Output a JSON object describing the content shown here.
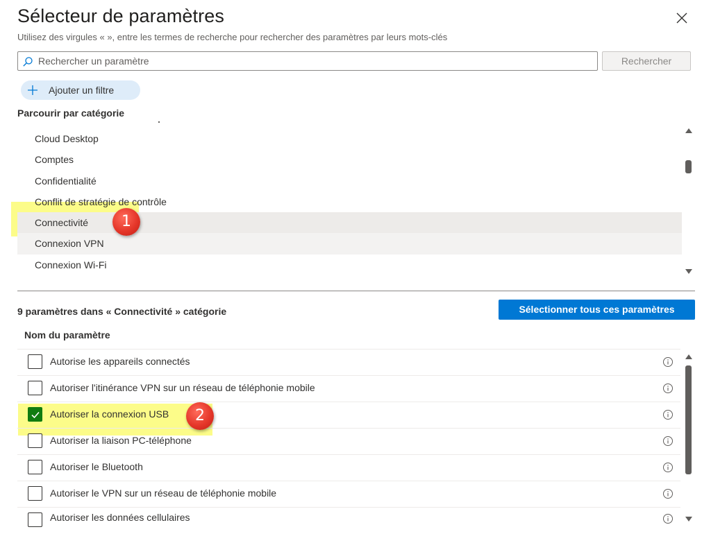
{
  "header": {
    "title": "Sélecteur de paramètres",
    "subtitle": "Utilisez des virgules « », entre les termes de recherche pour rechercher des paramètres par leurs mots-clés",
    "close_icon": "close-icon"
  },
  "search": {
    "placeholder": "Rechercher un paramètre",
    "value": "",
    "button_label": "Rechercher"
  },
  "filter": {
    "add_label": "Ajouter un filtre"
  },
  "categories": {
    "heading": "Parcourir par catégorie",
    "items": [
      {
        "label": "Cloud Desktop",
        "state": "normal"
      },
      {
        "label": "Comptes",
        "state": "normal"
      },
      {
        "label": "Confidentialité",
        "state": "normal"
      },
      {
        "label": "Conflit de stratégie de contrôle",
        "state": "normal"
      },
      {
        "label": "Connectivité",
        "state": "selected"
      },
      {
        "label": "Connexion VPN",
        "state": "hover"
      },
      {
        "label": "Connexion Wi-Fi",
        "state": "normal"
      }
    ]
  },
  "results": {
    "heading": "9 paramètres dans « Connectivité » catégorie",
    "select_all_label": "Sélectionner tous ces paramètres",
    "column_header": "Nom du paramètre",
    "items": [
      {
        "label": "Autorise les appareils connectés",
        "checked": false
      },
      {
        "label": "Autoriser l'itinérance VPN sur un réseau de téléphonie mobile",
        "checked": false
      },
      {
        "label": "Autoriser la connexion USB",
        "checked": true
      },
      {
        "label": "Autoriser la liaison PC-téléphone",
        "checked": false
      },
      {
        "label": "Autoriser le Bluetooth",
        "checked": false
      },
      {
        "label": "Autoriser le VPN sur un réseau de téléphonie mobile",
        "checked": false
      },
      {
        "label": "Autoriser les données cellulaires",
        "checked": false
      }
    ]
  },
  "annotations": {
    "step1": "1",
    "step2": "2",
    "highlight_color": "#fafa28",
    "badge_color": "#e5372a"
  },
  "colors": {
    "accent": "#0078d4",
    "checked": "#107c10",
    "selected_row": "#edebe9"
  }
}
